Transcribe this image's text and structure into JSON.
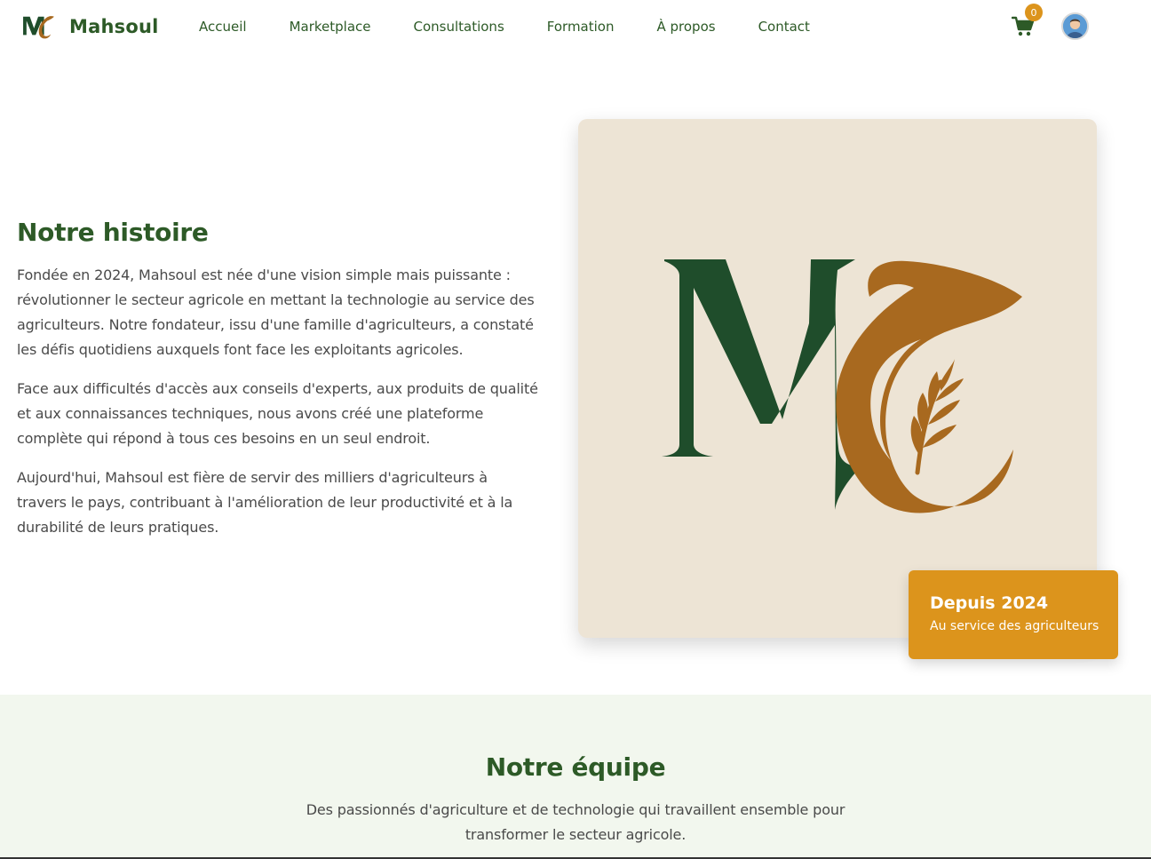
{
  "brand": {
    "name": "Mahsoul",
    "logo_icon": "mahsoul-mc-logo"
  },
  "nav": {
    "items": [
      {
        "label": "Accueil"
      },
      {
        "label": "Marketplace"
      },
      {
        "label": "Consultations"
      },
      {
        "label": "Formation"
      },
      {
        "label": "À propos"
      },
      {
        "label": "Contact"
      }
    ]
  },
  "header": {
    "cart_icon": "shopping-cart-icon",
    "cart_count": "0",
    "avatar_icon": "user-avatar"
  },
  "story": {
    "title": "Notre histoire",
    "paragraphs": [
      "Fondée en 2024, Mahsoul est née d'une vision simple mais puissante : révolutionner le secteur agricole en mettant la technologie au service des agriculteurs. Notre fondateur, issu d'une famille d'agriculteurs, a constaté les défis quotidiens auxquels font face les exploitants agricoles.",
      "Face aux difficultés d'accès aux conseils d'experts, aux produits de qualité et aux connaissances techniques, nous avons créé une plateforme complète qui répond à tous ces besoins en un seul endroit.",
      "Aujourd'hui, Mahsoul est fière de servir des milliers d'agriculteurs à travers le pays, contribuant à l'amélioration de leur productivité et à la durabilité de leurs pratiques."
    ],
    "badge": {
      "year_label": "Depuis 2024",
      "subtitle": "Au service des agriculteurs"
    }
  },
  "team": {
    "title": "Notre équipe",
    "subtitle": "Des passionnés d'agriculture et de technologie qui travaillent ensemble pour transformer le secteur agricole."
  },
  "colors": {
    "primary_green": "#2d5a27",
    "accent_gold": "#dc941c",
    "card_beige": "#ede4d5",
    "team_bg": "#f2f7ee",
    "logo_brown": "#a8691f"
  }
}
